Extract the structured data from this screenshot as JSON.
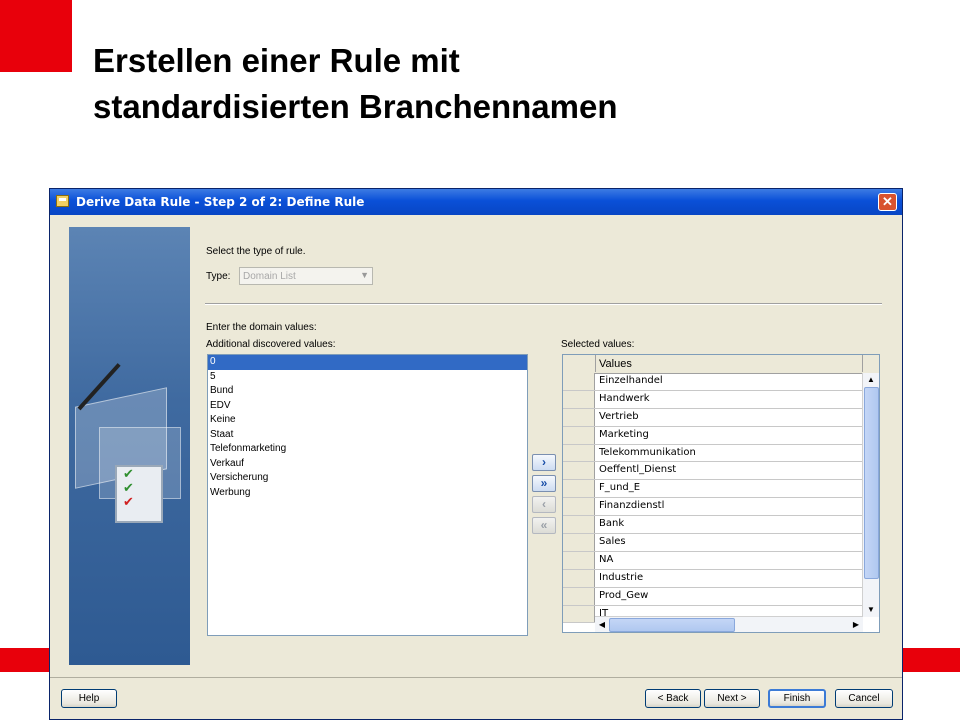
{
  "slide": {
    "title_line1": "Erstellen einer Rule mit",
    "title_line2": "standardisierten Branchennamen",
    "accent_color": "#e8000b"
  },
  "dialog": {
    "title": "Derive Data Rule - Step 2 of 2: Define Rule",
    "close_glyph": "✕",
    "select_type_label": "Select the type of rule.",
    "type_label": "Type:",
    "type_value": "Domain List",
    "domain_values_label": "Enter the domain values:",
    "additional_label": "Additional discovered values:",
    "selected_label": "Selected values:",
    "additional_values": [
      "0",
      "5",
      "Bund",
      "EDV",
      "Keine",
      "Staat",
      "Telefonmarketing",
      "Verkauf",
      "Versicherung",
      "Werbung"
    ],
    "selected_column_header": "Values",
    "selected_values": [
      "Einzelhandel",
      "Handwerk",
      "Vertrieb",
      "Marketing",
      "Telekommunikation",
      "Oeffentl_Dienst",
      "F_und_E",
      "Finanzdienstl",
      "Bank",
      "Sales",
      "NA",
      "Industrie",
      "Prod_Gew",
      "IT"
    ],
    "transfer_buttons": {
      "move_right": "›",
      "move_all_right": "»",
      "move_left": "‹",
      "move_all_left": "«"
    },
    "buttons": {
      "help": "Help",
      "back": "< Back",
      "next": "Next >",
      "finish": "Finish",
      "cancel": "Cancel"
    }
  }
}
